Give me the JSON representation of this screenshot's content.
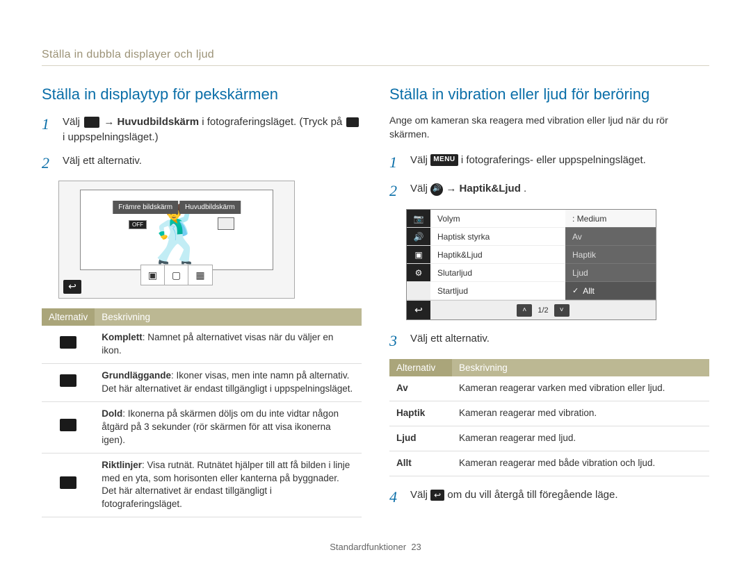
{
  "breadcrumb": "Ställa in dubbla displayer och ljud",
  "left": {
    "title": "Ställa in displaytyp för pekskärmen",
    "step1_a": "Välj ",
    "step1_b": " → ",
    "step1_bold": "Huvudbildskärm",
    "step1_c": " i fotograferingsläget. (Tryck på ",
    "step1_d": " i uppspelningsläget.)",
    "step2": "Välj ett alternativ.",
    "mock": {
      "tab_front": "Främre bildskärm",
      "tab_main": "Huvudbildskärm",
      "off": "OFF"
    },
    "table_headers": [
      "Alternativ",
      "Beskrivning"
    ],
    "rows": [
      {
        "term": "Komplett",
        "desc": ": Namnet på alternativet visas när du väljer en ikon."
      },
      {
        "term": "Grundläggande",
        "desc": ": Ikoner visas, men inte namn på alternativ. Det här alternativet är endast tillgängligt i uppspelningsläget."
      },
      {
        "term": "Dold",
        "desc": ": Ikonerna på skärmen döljs om du inte vidtar någon åtgärd på 3 sekunder (rör skärmen för att visa ikonerna igen)."
      },
      {
        "term": "Riktlinjer",
        "desc": ": Visa rutnät. Rutnätet hjälper till att få bilden i linje med en yta, som horisonten eller kanterna på byggnader. Det här alternativet är endast tillgängligt i fotograferingsläget."
      }
    ]
  },
  "right": {
    "title": "Ställa in vibration eller ljud för beröring",
    "intro": "Ange om kameran ska reagera med vibration eller ljud när du rör skärmen.",
    "step1_a": "Välj ",
    "step1_menu": "MENU",
    "step1_b": " i fotograferings- eller uppspelningsläget.",
    "step2_a": "Välj ",
    "step2_b": " → ",
    "step2_bold": "Haptik&Ljud",
    "step2_c": ".",
    "mock": {
      "labels": [
        "Volym",
        "Haptisk styrka",
        "Haptik&Ljud",
        "Slutarljud",
        "Startljud"
      ],
      "value_header": ": Medium",
      "options": [
        "Av",
        "Haptik",
        "Ljud",
        "Allt"
      ],
      "selected": "Allt",
      "pager": "1/2"
    },
    "step3": "Välj ett alternativ.",
    "table_headers": [
      "Alternativ",
      "Beskrivning"
    ],
    "options": [
      {
        "key": "Av",
        "desc": "Kameran reagerar varken med vibration eller ljud."
      },
      {
        "key": "Haptik",
        "desc": "Kameran reagerar med vibration."
      },
      {
        "key": "Ljud",
        "desc": "Kameran reagerar med ljud."
      },
      {
        "key": "Allt",
        "desc": "Kameran reagerar med både vibration och ljud."
      }
    ],
    "step4_a": "Välj ",
    "step4_b": " om du vill återgå till föregående läge."
  },
  "footer": {
    "section": "Standardfunktioner",
    "page": "23"
  }
}
